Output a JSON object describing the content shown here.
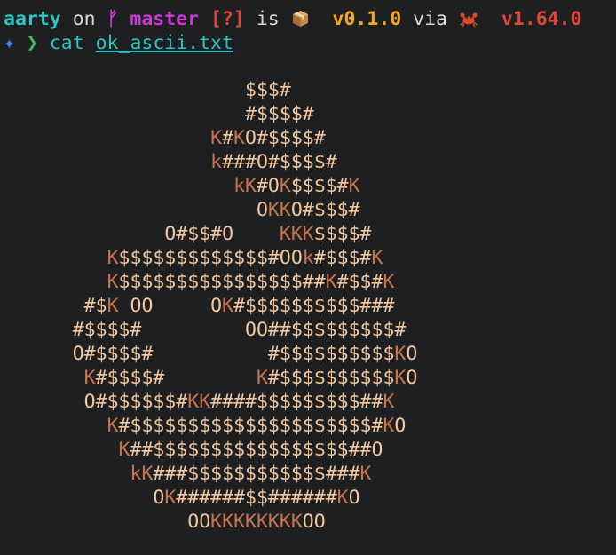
{
  "prompt": {
    "user": "aarty",
    "on": "on",
    "branch_symbol": "ᚠ",
    "branch": "master",
    "status": "[?]",
    "is": "is",
    "package_icon": "package-icon",
    "version": "v0.1.0",
    "via": "via",
    "rust_icon": "crab-icon",
    "rust_version": "v1.64.0"
  },
  "command": {
    "prefix_icon": "star-icon",
    "chevron": "❯",
    "command": "cat",
    "argument": "ok_ascii.txt"
  },
  "output": {
    "lines": [
      "                     $$$#",
      "                     #$$$$#",
      "                  K#KO#$$$$#",
      "                  k###O#$$$$#",
      "                    kK#OK$$$$#K",
      "                      OKKO#$$$#",
      "              O#$$#O    KKK$$$$#",
      "         K$$$$$$$$$$$$$#OOk#$$$#K",
      "         K$$$$$$$$$$$$$$$$##K#$$#K",
      "       #$K OO     OK#$$$$$$$$$$###",
      "      #$$$$#         OO##$$$$$$$$$#",
      "      O#$$$$#          #$$$$$$$$$$KO",
      "       K#$$$$#        K#$$$$$$$$$$KO",
      "       O#$$$$$$#KK####$$$$$$$$$##K",
      "         K#$$$$$$$$$$$$$$$$$$$$$#KO",
      "          K##$$$$$$$$$$$$$$$$$##O",
      "           kK###$$$$$$$$$$$$###K",
      "             OK######$$######KO",
      "                OOKKKKKKKKOO"
    ]
  }
}
